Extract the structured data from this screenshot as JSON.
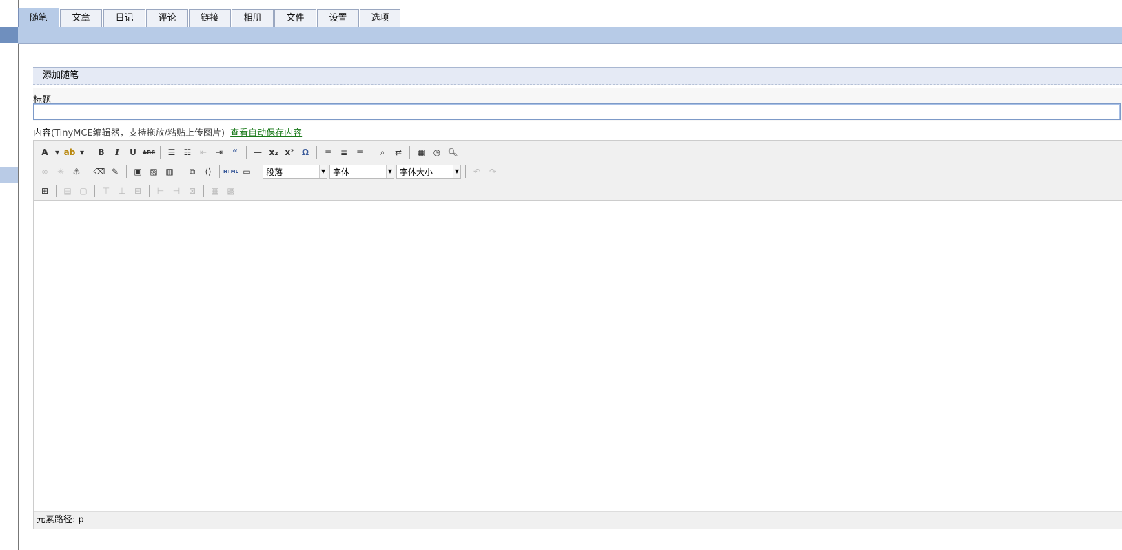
{
  "tabs": [
    {
      "label": "随笔",
      "active": true
    },
    {
      "label": "文章"
    },
    {
      "label": "日记"
    },
    {
      "label": "评论"
    },
    {
      "label": "链接"
    },
    {
      "label": "相册"
    },
    {
      "label": "文件"
    },
    {
      "label": "设置"
    },
    {
      "label": "选项"
    }
  ],
  "section": {
    "title": "添加随笔"
  },
  "form": {
    "title_label": "标题",
    "title_value": "",
    "content_label": "内容",
    "content_desc": "(TinyMCE编辑器，支持拖放/粘贴上传图片)",
    "autosave_link": "查看自动保存内容"
  },
  "editor": {
    "format_select": "段落",
    "font_select": "字体",
    "size_select": "字体大小",
    "status_path": "元素路径: p"
  }
}
